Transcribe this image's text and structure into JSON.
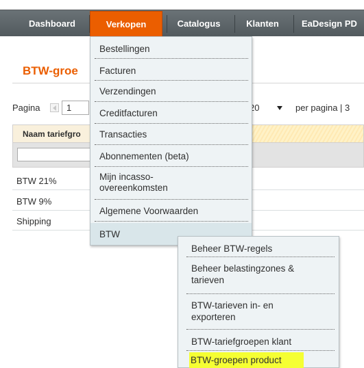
{
  "nav": {
    "items": [
      "Dashboard",
      "Verkopen",
      "Catalogus",
      "Klanten",
      "EaDesign PD"
    ],
    "active_color": "#eb5e00"
  },
  "page": {
    "title": "BTW-groe"
  },
  "pager": {
    "label": "Pagina",
    "page_value": "1",
    "per_page_value": "20",
    "per_page_label": "per pagina  |  3"
  },
  "grid": {
    "header": "Naam tariefgro",
    "rows": [
      "BTW 21%",
      "BTW 9%",
      "Shipping"
    ]
  },
  "menu": {
    "items": [
      "Bestellingen",
      "Facturen",
      "Verzendingen",
      "Creditfacturen",
      "Transacties",
      "Abonnementen (beta)",
      "Mijn incasso- overeenkomsten",
      "Algemene Voorwaarden"
    ],
    "last": "BTW"
  },
  "submenu": {
    "items": [
      "Beheer BTW-regels",
      "Beheer belastingzones & tarieven",
      "BTW-tarieven in- en exporteren",
      "BTW-tariefgroepen klant",
      "BTW-groepen product"
    ],
    "highlight_color": "#f5ff33"
  }
}
